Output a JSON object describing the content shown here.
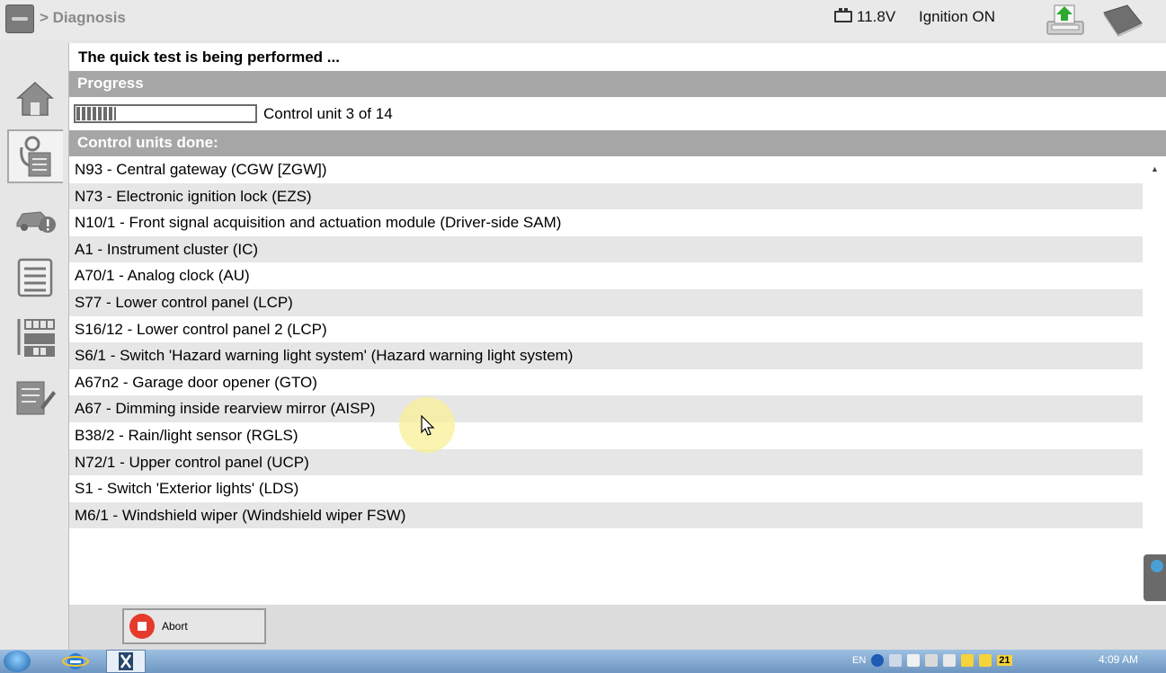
{
  "header": {
    "breadcrumb": "> Diagnosis",
    "voltage": "11.8V",
    "ignition": "Ignition ON"
  },
  "sidebar": {
    "items": [
      {
        "icon": "home-icon"
      },
      {
        "icon": "diagnosis-icon",
        "active": true
      },
      {
        "icon": "vehicle-warning-icon"
      },
      {
        "icon": "document-list-icon"
      },
      {
        "icon": "control-unit-grid-icon"
      },
      {
        "icon": "report-edit-icon"
      }
    ]
  },
  "main": {
    "status_title": "The quick test is being performed ...",
    "progress_header": "Progress",
    "progress_fraction": 0.22,
    "progress_text": "Control unit 3 of 14",
    "done_header": "Control units done:",
    "control_units": [
      "N93 - Central gateway (CGW [ZGW])",
      "N73 - Electronic ignition lock (EZS)",
      "N10/1 - Front signal acquisition and actuation module (Driver-side SAM)",
      "A1 - Instrument cluster (IC)",
      "A70/1 - Analog clock (AU)",
      "S77 - Lower control panel (LCP)",
      "S16/12 - Lower control panel 2 (LCP)",
      "S6/1 - Switch 'Hazard warning light system' (Hazard warning light system)",
      "A67n2 - Garage door opener (GTO)",
      "A67 - Dimming inside rearview mirror (AISP)",
      "B38/2 - Rain/light sensor (RGLS)",
      "N72/1 - Upper control panel (UCP)",
      "S1 - Switch 'Exterior lights' (LDS)",
      "M6/1 - Windshield wiper (Windshield wiper FSW)"
    ]
  },
  "actions": {
    "abort_label": "Abort"
  },
  "taskbar": {
    "language": "EN",
    "clock_time": "4:09 AM",
    "tray_badge": "21"
  },
  "colors": {
    "section_header": "#a6a6a6",
    "row_alt": "#e6e6e6",
    "abort_red": "#e53a2c"
  }
}
